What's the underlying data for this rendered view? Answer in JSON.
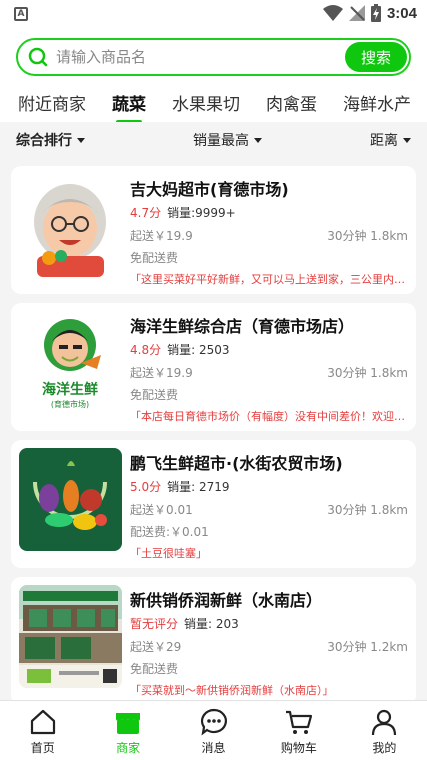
{
  "status": {
    "time": "3:04"
  },
  "search": {
    "placeholder": "请输入商品名",
    "button": "搜索"
  },
  "tabs": [
    "附近商家",
    "蔬菜",
    "水果果切",
    "肉禽蛋",
    "海鲜水产"
  ],
  "active_tab": 1,
  "sort": {
    "comprehensive": "综合排行",
    "sales": "销量最高",
    "distance": "距离"
  },
  "stores": [
    {
      "name": "吉大妈超市(育德市场)",
      "rating": "4.7分",
      "sales": "销量:9999+",
      "min_order": "起送￥19.9",
      "time_distance": "30分钟 1.8km",
      "delivery_fee": "免配送费",
      "notice": "「这里买菜好平好新鲜，又可以马上送到家，三公里内包邮」"
    },
    {
      "name": "海洋生鲜综合店（育德市场店）",
      "rating": "4.8分",
      "sales": "销量: 2503",
      "min_order": "起送￥19.9",
      "time_distance": "30分钟 1.8km",
      "delivery_fee": "免配送费",
      "notice": "「本店每日育德市场价（有幅度）没有中间差价！欢迎选购」",
      "logo_text": "海洋生鲜",
      "logo_sub": "(育德市场)"
    },
    {
      "name": "鹏飞生鲜超市·(水街农贸市场)",
      "rating": "5.0分",
      "sales": "销量: 2719",
      "min_order": "起送￥0.01",
      "time_distance": "30分钟 1.8km",
      "delivery_fee": "配送费:￥0.01",
      "notice": "「土豆很哇塞」"
    },
    {
      "name": "新供销侨润新鲜（水南店）",
      "rating": "暂无评分",
      "sales": "销量: 203",
      "min_order": "起送￥29",
      "time_distance": "30分钟 1.2km",
      "delivery_fee": "免配送费",
      "notice": "「买菜就到～新供销侨润新鲜（水南店）」"
    }
  ],
  "nav": [
    "首页",
    "商家",
    "消息",
    "购物车",
    "我的"
  ],
  "colors": {
    "accent": "#10c70f",
    "price_red": "#e43d3d"
  }
}
